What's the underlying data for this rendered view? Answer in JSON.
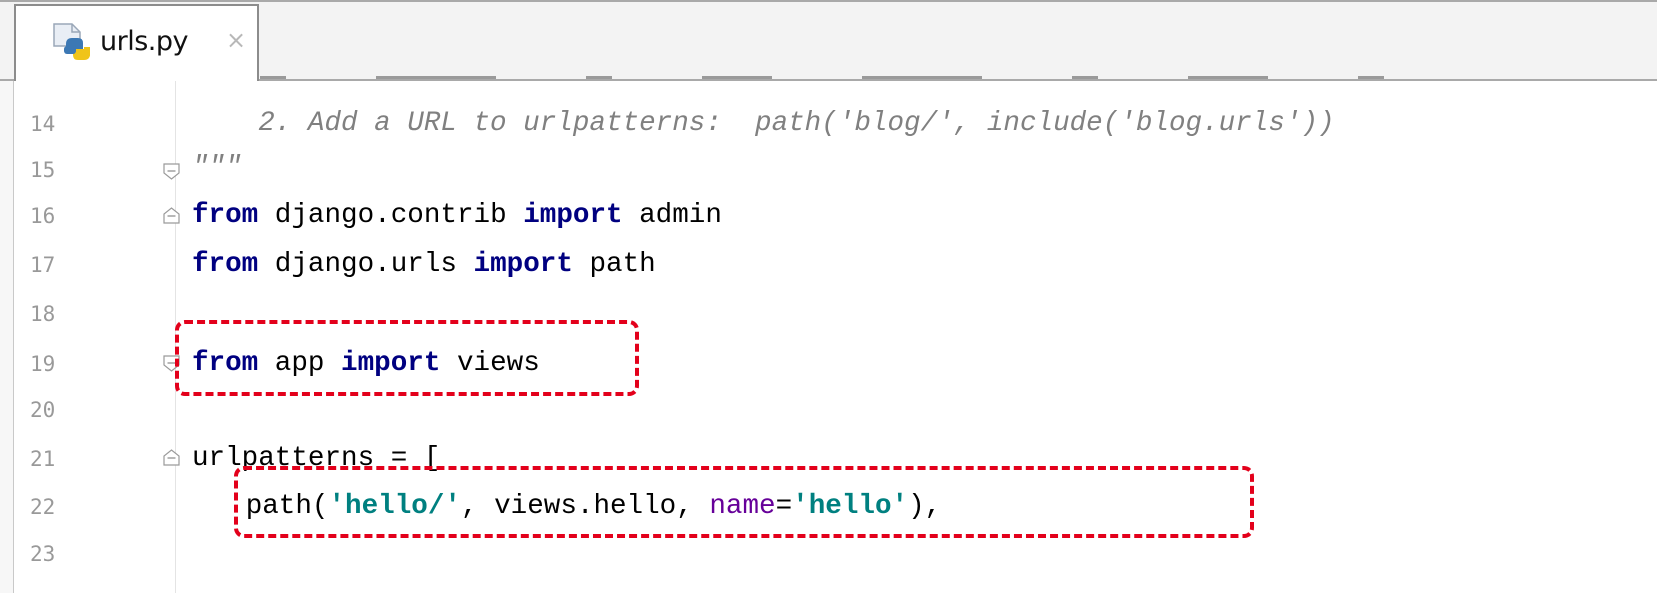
{
  "tab": {
    "title": "urls.py",
    "close_glyph": "×",
    "icon": "python-file-icon"
  },
  "gutter": {
    "line_numbers": [
      "14",
      "15",
      "16",
      "17",
      "18",
      "19",
      "20",
      "21",
      "22",
      "23"
    ]
  },
  "code": {
    "line14": {
      "comment": "    2. Add a URL to urlpatterns:  path('blog/', include('blog.urls'))"
    },
    "line15": {
      "docstring_end": "\"\"\""
    },
    "line16": {
      "kw_from": "from",
      "module": " django.contrib ",
      "kw_import": "import",
      "name": " admin"
    },
    "line17": {
      "kw_from": "from",
      "module": " django.urls ",
      "kw_import": "import",
      "name": " path"
    },
    "line19": {
      "kw_from": "from",
      "module": " app ",
      "kw_import": "import",
      "name": " views"
    },
    "line21": {
      "text": "urlpatterns = ["
    },
    "line22": {
      "indent": "   ",
      "func": "path(",
      "arg1": "'hello/'",
      "mid": ", views.hello, ",
      "kwarg": "name",
      "eq": "=",
      "arg2": "'hello'",
      "tail": "),"
    }
  },
  "colors": {
    "keyword": "#000080",
    "string": "#008080",
    "comment": "#808080",
    "kwarg": "#660099",
    "highlight_box": "#e3001b"
  }
}
